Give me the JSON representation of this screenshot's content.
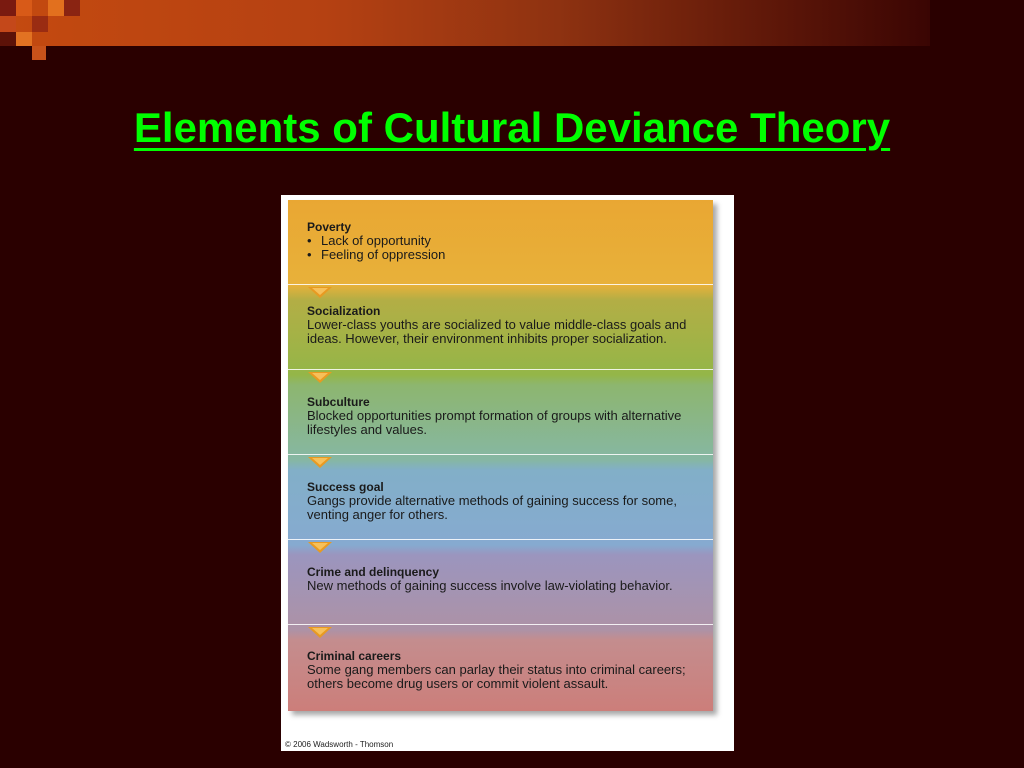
{
  "title": "Elements of Cultural Deviance Theory",
  "figure": {
    "sections": [
      {
        "heading": "Poverty",
        "bullets": [
          "Lack of opportunity",
          "Feeling of oppression"
        ]
      },
      {
        "heading": "Socialization",
        "text": "Lower-class youths are socialized to value middle-class goals and ideas. However, their environment inhibits proper socialization."
      },
      {
        "heading": "Subculture",
        "text": "Blocked opportunities prompt formation of groups with alternative lifestyles and values."
      },
      {
        "heading": "Success goal",
        "text": "Gangs provide alternative methods of gaining success for some, venting anger for others."
      },
      {
        "heading": "Crime and delinquency",
        "text": "New methods of gaining success involve law-violating behavior."
      },
      {
        "heading": "Criminal careers",
        "text": "Some gang members can parlay their status into criminal careers; others become drug users or commit violent assault."
      }
    ],
    "copyright": "© 2006 Wadsworth - Thomson"
  }
}
